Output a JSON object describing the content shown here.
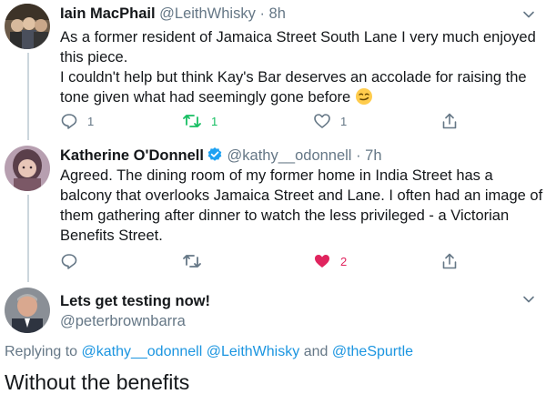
{
  "tweets": [
    {
      "name": "Iain MacPhail",
      "handle": "@LeithWhisky",
      "dot": "·",
      "time": "8h",
      "lines": [
        "As a former resident of Jamaica Street South Lane I very much enjoyed",
        "this piece.",
        "I couldn't help but think Kay's Bar deserves an accolade for raising the",
        "tone given what had seemingly gone before"
      ],
      "emoji": "smirk-face-emoji",
      "replies": "1",
      "retweets": "1",
      "likes": "1"
    },
    {
      "name": "Katherine O'Donnell",
      "handle": "@kathy__odonnell",
      "dot": "·",
      "time": "7h",
      "lines": [
        "Agreed. The dining room of my former home in India Street has a",
        "balcony that overlooks Jamaica Street and Lane. I often had an image of",
        "them gathering after dinner to watch the less privileged - a Victorian",
        "Benefits Street."
      ],
      "replies": "",
      "retweets": "",
      "likes": "2",
      "liked": true
    },
    {
      "name": "Lets get testing now!",
      "handle": "@peterbrownbarra"
    }
  ],
  "reply_to": {
    "prefix": "Replying to",
    "mention1": "@kathy__odonnell",
    "mention2": "@LeithWhisky",
    "conj": "and",
    "mention3": "@theSpurtle"
  },
  "compose_text": "Without the benefits",
  "colors": {
    "text": "#14171a",
    "secondary": "#657786",
    "retweet_green": "#17bf63",
    "like_red": "#e0245e",
    "link_blue": "#1b95e0",
    "verified_blue": "#1da1f2"
  }
}
